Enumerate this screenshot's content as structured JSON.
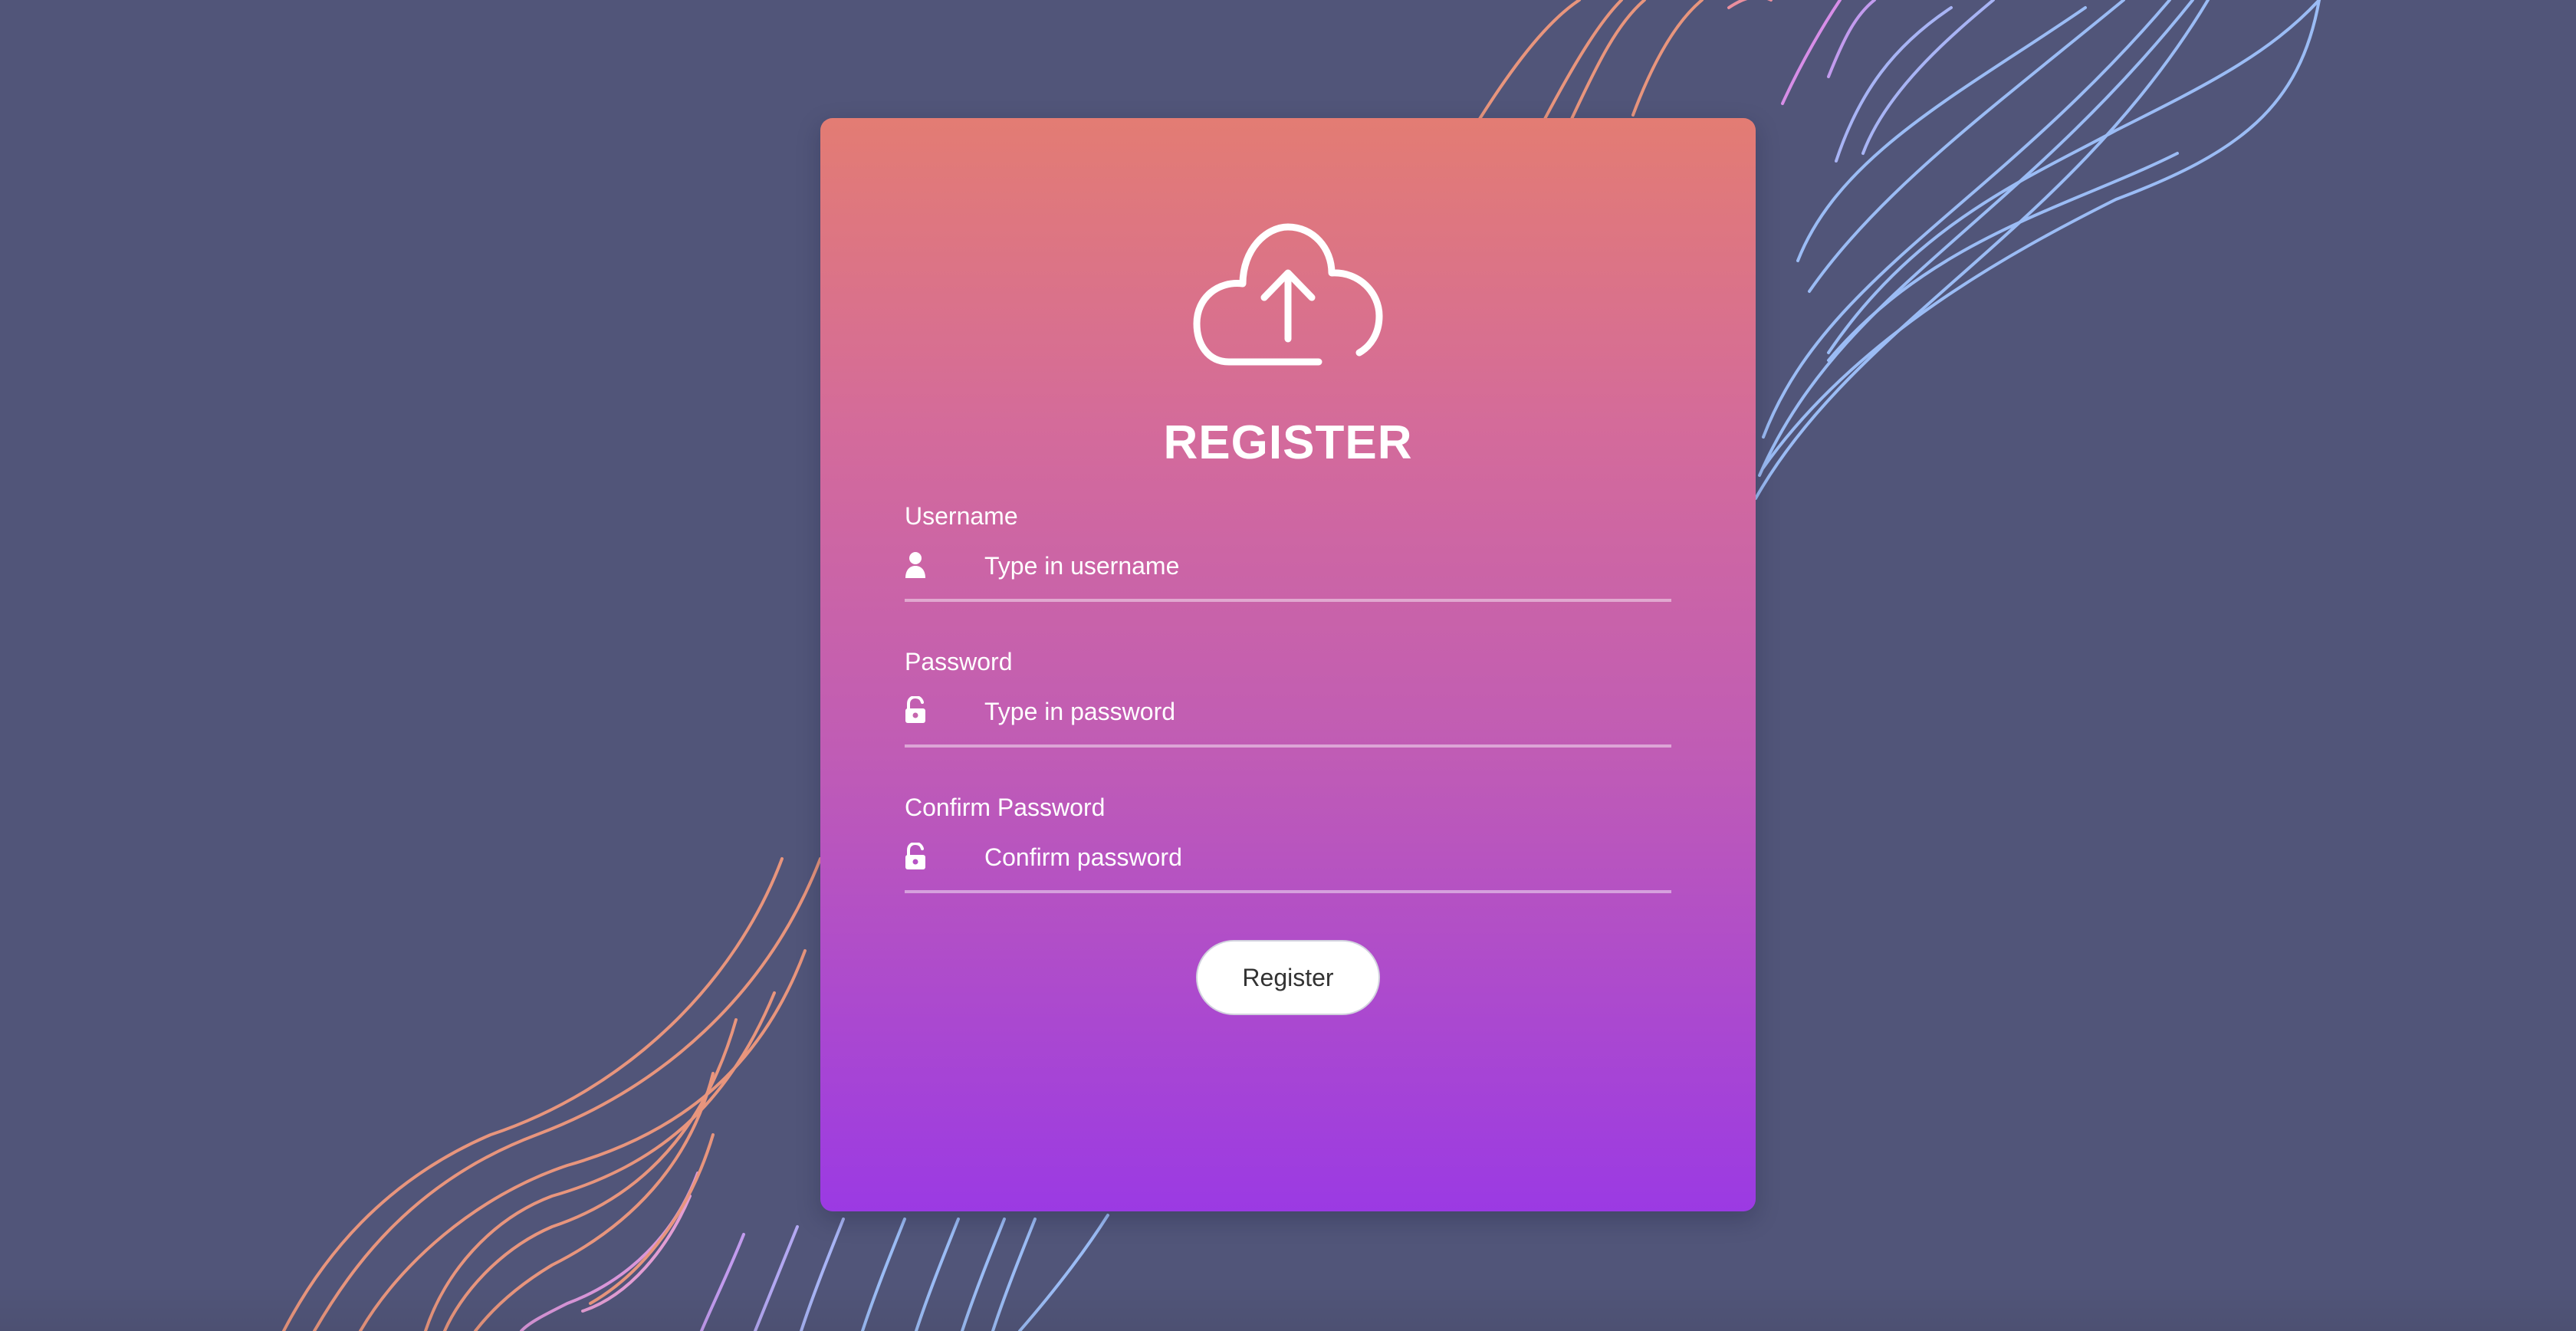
{
  "header": {
    "icon": "cloud-upload-icon",
    "title": "REGISTER"
  },
  "form": {
    "fields": [
      {
        "label": "Username",
        "icon": "user-icon",
        "placeholder": "Type in username"
      },
      {
        "label": "Password",
        "icon": "unlock-icon",
        "placeholder": "Type in password"
      },
      {
        "label": "Confirm Password",
        "icon": "unlock-icon",
        "placeholder": "Confirm password"
      }
    ],
    "submit_label": "Register"
  },
  "colors": {
    "background": "#515579",
    "card_gradient_top": "#e37c73",
    "card_gradient_bottom": "#9b3ae3",
    "text": "#ffffff",
    "button_background": "#ffffff",
    "button_text": "#333333"
  }
}
